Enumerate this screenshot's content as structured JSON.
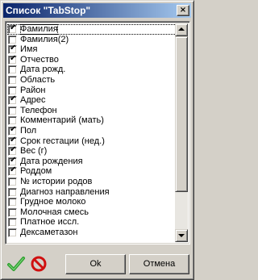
{
  "window": {
    "title": "Список \"TabStop\"",
    "close_glyph": "×"
  },
  "list": {
    "items": [
      {
        "label": "Фамилия",
        "checked": true,
        "focused": true
      },
      {
        "label": "Фамилия(2)",
        "checked": false
      },
      {
        "label": "Имя",
        "checked": true
      },
      {
        "label": "Отчество",
        "checked": true
      },
      {
        "label": "Дата рожд.",
        "checked": false
      },
      {
        "label": "Область",
        "checked": false
      },
      {
        "label": "Район",
        "checked": false
      },
      {
        "label": "Адрес",
        "checked": true
      },
      {
        "label": "Телефон",
        "checked": false
      },
      {
        "label": "Комментарий (мать)",
        "checked": false
      },
      {
        "label": "Пол",
        "checked": true
      },
      {
        "label": "Срок гестации (нед.)",
        "checked": true
      },
      {
        "label": "Вес (г)",
        "checked": true
      },
      {
        "label": "Дата рождения",
        "checked": true
      },
      {
        "label": "Роддом",
        "checked": true
      },
      {
        "label": "№ истории родов",
        "checked": false
      },
      {
        "label": "Диагноз направления",
        "checked": false
      },
      {
        "label": "Грудное молоко",
        "checked": false
      },
      {
        "label": "Молочная смесь",
        "checked": false
      },
      {
        "label": "Платное иссл.",
        "checked": false
      },
      {
        "label": "Дексаметазон",
        "checked": false
      }
    ],
    "check_glyph": "✔"
  },
  "buttons": {
    "ok_label": "Ok",
    "cancel_label": "Отмена"
  },
  "colors": {
    "title_bar_start": "#0a246a",
    "title_bar_end": "#a6caf0",
    "check_icon_green": "#2ea02e",
    "cancel_icon_red": "#d01010"
  },
  "icons": {
    "check_all": "green-check-icon",
    "uncheck_all": "red-no-sign-icon"
  }
}
